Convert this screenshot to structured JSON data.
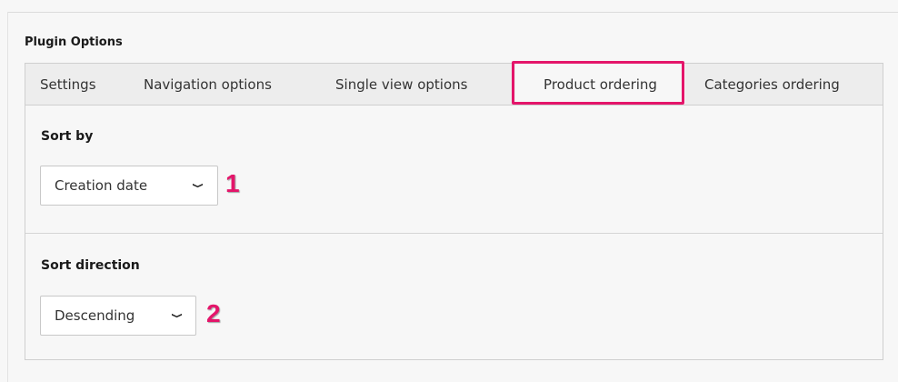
{
  "panel": {
    "title": "Plugin Options"
  },
  "tabs": [
    {
      "label": "Settings"
    },
    {
      "label": "Navigation options"
    },
    {
      "label": "Single view options"
    },
    {
      "label": "Product ordering"
    },
    {
      "label": "Categories ordering"
    }
  ],
  "active_tab": "Product ordering",
  "sort_by": {
    "label": "Sort by",
    "selected": "Creation date",
    "marker": "1"
  },
  "sort_direction": {
    "label": "Sort direction",
    "selected": "Descending",
    "marker": "2"
  },
  "icons": {
    "dropdown": "chevron-down-icon"
  },
  "colors": {
    "highlight": "#e4156a"
  }
}
